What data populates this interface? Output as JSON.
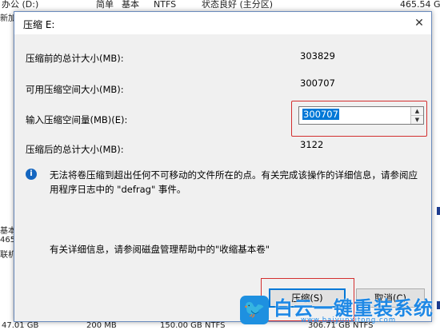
{
  "background": {
    "top_row": [
      "办公 (D:)",
      "简单",
      "基本",
      "NTFS",
      "状态良好 (主分区)",
      "465.54 G"
    ],
    "left_fragments": [
      "新加",
      "基本",
      "465.",
      "联机",
      "47.01 GB"
    ],
    "bottom_fragments": [
      "47.01 GB",
      "200 MB",
      "150.00 GB NTFS",
      "306.71 GB NTFS"
    ]
  },
  "dialog": {
    "title": "压缩 E:",
    "close_icon": "close-icon",
    "rows": [
      {
        "label": "压缩前的总计大小(MB):",
        "value": "303829"
      },
      {
        "label": "可用压缩空间大小(MB):",
        "value": "300707"
      },
      {
        "label": "输入压缩空间量(MB)(E):",
        "value": "300707"
      },
      {
        "label": "压缩后的总计大小(MB):",
        "value": "3122"
      }
    ],
    "info_icon": "info-icon",
    "info_text": "无法将卷压缩到超出任何不可移动的文件所在的点。有关完成该操作的详细信息，请参阅应用程序日志中的 \"defrag\" 事件。",
    "help_text": "有关详细信息，请参阅磁盘管理帮助中的\"收缩基本卷\"",
    "shrink_button": "压缩(S)",
    "cancel_button": "取消(C)"
  },
  "watermark": {
    "text": "白云一键重装系统",
    "url": "www.baiyunxitong.com"
  },
  "colors": {
    "accent": "#0078d7",
    "highlight": "#d32f2f",
    "info": "#1566c0"
  }
}
